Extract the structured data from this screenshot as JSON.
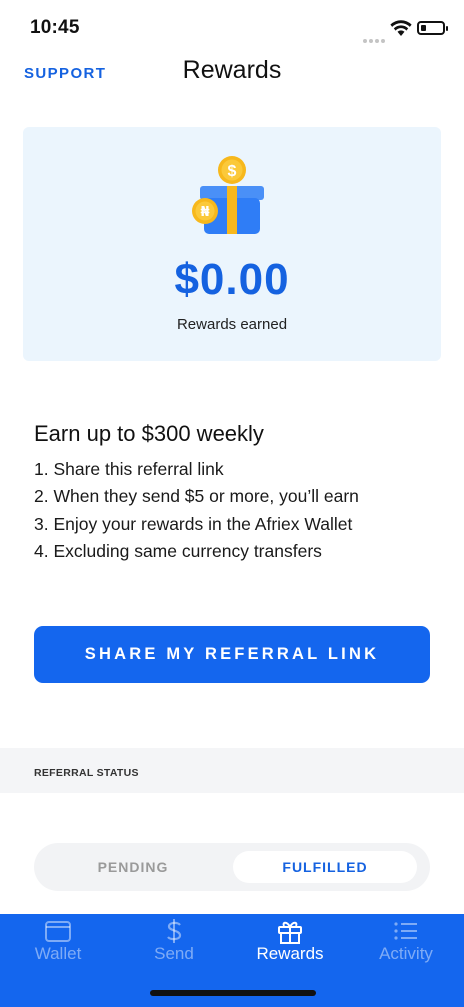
{
  "status_bar": {
    "time": "10:45"
  },
  "header": {
    "support_label": "SUPPORT",
    "title": "Rewards"
  },
  "rewards_card": {
    "amount": "$0.00",
    "label": "Rewards earned",
    "coin_symbol_top": "$",
    "coin_symbol_side": "₦"
  },
  "info": {
    "title": "Earn up to $300 weekly",
    "steps": [
      "1. Share this referral link",
      "2. When they send $5 or more, you’ll earn",
      "3. Enjoy your rewards in the Afriex Wallet",
      "4. Excluding same currency transfers"
    ]
  },
  "cta": {
    "share_label": "SHARE MY REFERRAL LINK"
  },
  "referral_status": {
    "header": "REFERRAL STATUS",
    "tabs": {
      "pending": "PENDING",
      "fulfilled": "FULFILLED"
    },
    "selected": "fulfilled"
  },
  "tab_bar": {
    "items": [
      {
        "label": "Wallet",
        "icon": "wallet-icon",
        "active": false
      },
      {
        "label": "Send",
        "icon": "dollar-icon",
        "active": false
      },
      {
        "label": "Rewards",
        "icon": "gift-icon",
        "active": true
      },
      {
        "label": "Activity",
        "icon": "list-icon",
        "active": false
      }
    ]
  },
  "colors": {
    "accent": "#1466ee",
    "card_bg": "#ebf5fd",
    "gift_box": "#2f7df6",
    "gift_ribbon": "#f7b81c"
  }
}
